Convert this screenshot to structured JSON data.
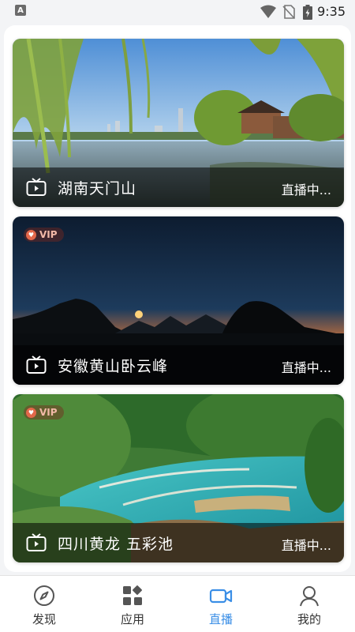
{
  "status_bar": {
    "app_badge": "A",
    "time": "9:35"
  },
  "cards": [
    {
      "title": "湖南天门山",
      "status": "直播中...",
      "vip": false
    },
    {
      "title": "安徽黄山卧云峰",
      "status": "直播中...",
      "vip": true,
      "vip_label": "VIP"
    },
    {
      "title": "四川黄龙 五彩池",
      "status": "直播中...",
      "vip": true,
      "vip_label": "VIP"
    }
  ],
  "tabs": [
    {
      "label": "发现",
      "icon": "compass-icon",
      "active": false
    },
    {
      "label": "应用",
      "icon": "apps-grid-icon",
      "active": false
    },
    {
      "label": "直播",
      "icon": "video-camera-icon",
      "active": true
    },
    {
      "label": "我的",
      "icon": "user-icon",
      "active": false
    }
  ],
  "colors": {
    "accent": "#3a8ee6",
    "tab_inactive": "#333333",
    "vip_badge": "#e4674a"
  }
}
